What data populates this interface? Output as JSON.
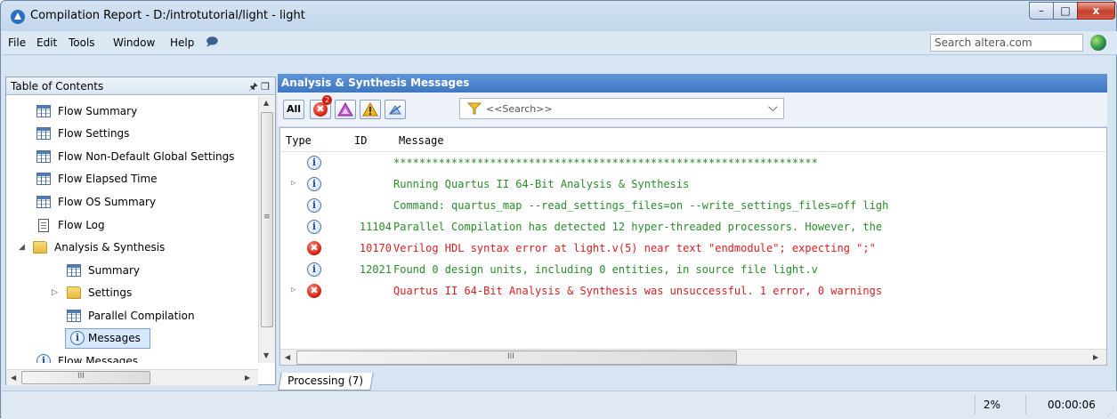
{
  "window": {
    "title": "Compilation Report - D:/introtutorial/light - light",
    "controls": {
      "minimize": "–",
      "maximize": "□",
      "close": "x"
    }
  },
  "menu": {
    "items": [
      "File",
      "Edit",
      "Tools",
      "Window",
      "Help"
    ],
    "search_placeholder": "Search altera.com"
  },
  "toc": {
    "header": "Table of Contents",
    "items": [
      {
        "label": "Flow Summary",
        "icon": "table-icon"
      },
      {
        "label": "Flow Settings",
        "icon": "table-icon"
      },
      {
        "label": "Flow Non-Default Global Settings",
        "icon": "table-icon"
      },
      {
        "label": "Flow Elapsed Time",
        "icon": "table-icon"
      },
      {
        "label": "Flow OS Summary",
        "icon": "table-icon"
      },
      {
        "label": "Flow Log",
        "icon": "document-icon"
      },
      {
        "label": "Analysis & Synthesis",
        "icon": "folder-open-icon"
      },
      {
        "label": "Summary",
        "icon": "table-icon"
      },
      {
        "label": "Settings",
        "icon": "folder-icon"
      },
      {
        "label": "Parallel Compilation",
        "icon": "table-icon"
      },
      {
        "label": "Messages",
        "icon": "info-icon"
      },
      {
        "label": "Flow Messages",
        "icon": "info-icon"
      }
    ],
    "hscroll_glyph": "III",
    "vscroll_glyph": "≡"
  },
  "messages_pane": {
    "title": "Analysis & Synthesis Messages",
    "toolbar": {
      "all_label": "All",
      "error_badge": "2",
      "filter_placeholder": "<<Search>>"
    },
    "columns": [
      "Type",
      "ID",
      "Message"
    ],
    "rows": [
      {
        "type": "info",
        "expandable": false,
        "id": "",
        "text": "******************************************************************",
        "color": "#2b8a2b"
      },
      {
        "type": "info",
        "expandable": true,
        "id": "",
        "text": "Running Quartus II 64-Bit Analysis & Synthesis",
        "color": "#2b8a2b"
      },
      {
        "type": "info",
        "expandable": false,
        "id": "",
        "text": "Command: quartus_map --read_settings_files=on --write_settings_files=off ligh",
        "color": "#2b8a2b"
      },
      {
        "type": "info",
        "expandable": false,
        "id": "11104",
        "text": "Parallel Compilation has detected 12 hyper-threaded processors. However, the",
        "color": "#2b8a2b"
      },
      {
        "type": "error",
        "expandable": false,
        "id": "10170",
        "text": "Verilog HDL syntax error at light.v(5) near text \"endmodule\";  expecting \";\"",
        "color": "#d42020"
      },
      {
        "type": "info",
        "expandable": false,
        "id": "12021",
        "text": "Found 0 design units, including 0 entities, in source file light.v",
        "color": "#2b8a2b"
      },
      {
        "type": "error",
        "expandable": true,
        "id": "",
        "text": "Quartus II 64-Bit Analysis & Synthesis was unsuccessful. 1 error, 0 warnings",
        "color": "#d42020"
      }
    ],
    "hscroll_glyph": "III",
    "tab_label": "Processing (7)"
  },
  "status": {
    "progress": "2%",
    "elapsed": "00:00:06"
  }
}
